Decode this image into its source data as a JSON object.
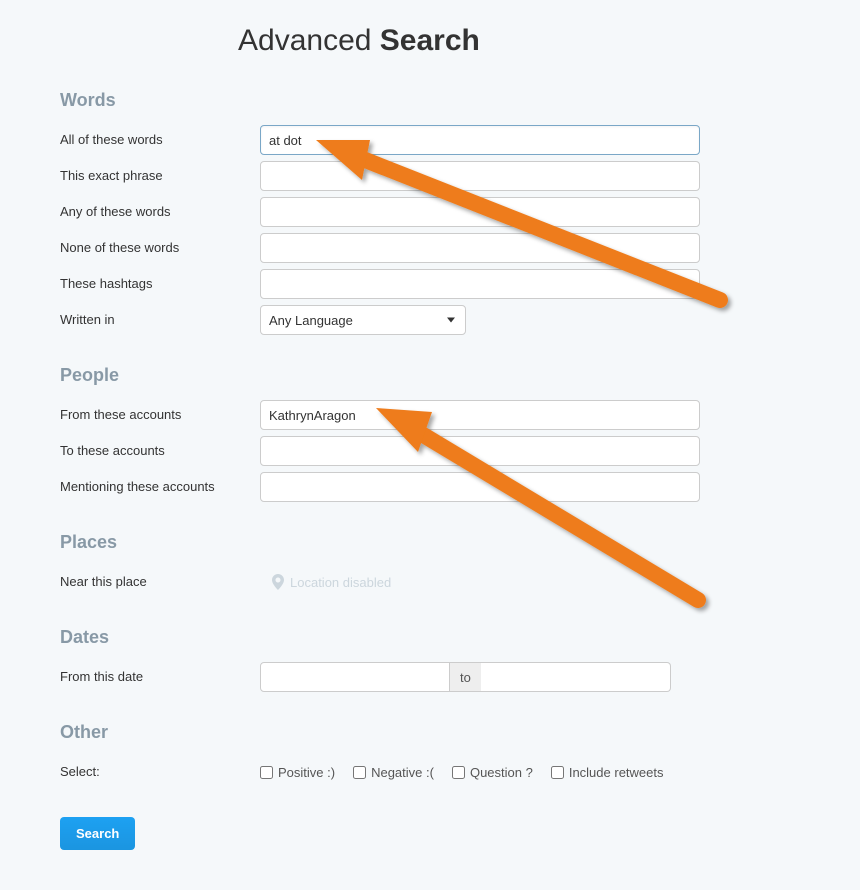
{
  "title": {
    "light": "Advanced",
    "bold": "Search"
  },
  "sections": {
    "words": {
      "heading": "Words",
      "all_label": "All of these words",
      "all_value": "at dot",
      "exact_label": "This exact phrase",
      "exact_value": "",
      "any_label": "Any of these words",
      "any_value": "",
      "none_label": "None of these words",
      "none_value": "",
      "hashtags_label": "These hashtags",
      "hashtags_value": "",
      "lang_label": "Written in",
      "lang_value": "Any Language"
    },
    "people": {
      "heading": "People",
      "from_label": "From these accounts",
      "from_value": "KathrynAragon",
      "to_label": "To these accounts",
      "to_value": "",
      "mention_label": "Mentioning these accounts",
      "mention_value": ""
    },
    "places": {
      "heading": "Places",
      "near_label": "Near this place",
      "disabled_text": "Location disabled"
    },
    "dates": {
      "heading": "Dates",
      "from_label": "From this date",
      "sep": "to"
    },
    "other": {
      "heading": "Other",
      "select_label": "Select:",
      "positive": "Positive :)",
      "negative": "Negative :(",
      "question": "Question ?",
      "retweets": "Include retweets"
    }
  },
  "search_button": "Search"
}
